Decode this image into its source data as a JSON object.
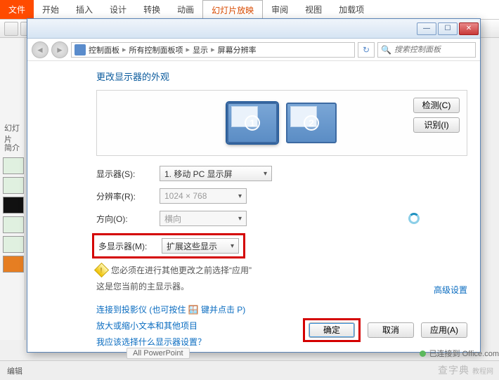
{
  "ribbon": {
    "file": "文件",
    "tabs": [
      "开始",
      "插入",
      "设计",
      "转换",
      "动画",
      "幻灯片放映",
      "审阅",
      "视图",
      "加载项"
    ],
    "active_index": 5
  },
  "left_panel": {
    "label_slides": "幻灯片",
    "label_outline": "简介"
  },
  "window": {
    "controls": {
      "min": "—",
      "max": "☐",
      "close": "✕"
    },
    "breadcrumb": [
      "控制面板",
      "所有控制面板项",
      "显示",
      "屏幕分辨率"
    ],
    "search_placeholder": "搜索控制面板",
    "heading": "更改显示器的外观",
    "panel_buttons": {
      "detect": "检测(C)",
      "identify": "识别(I)"
    },
    "monitors": [
      "1",
      "2"
    ],
    "labels": {
      "display": "显示器(S):",
      "resolution": "分辨率(R):",
      "orientation": "方向(O):",
      "multi": "多显示器(M):"
    },
    "values": {
      "display": "1. 移动 PC 显示屏",
      "resolution": "1024 × 768",
      "orientation": "横向",
      "multi": "扩展这些显示"
    },
    "warn": "您必须在进行其他更改之前选择“应用”",
    "primary_note": "这是您当前的主显示器。",
    "advanced": "高级设置",
    "links": {
      "projector": "连接到投影仪 (也可按住 🪟 键并点击 P)",
      "textsize": "放大或缩小文本和其他项目",
      "whichsetting": "我应该选择什么显示器设置？"
    },
    "buttons": {
      "ok": "确定",
      "cancel": "取消",
      "apply": "应用(A)"
    }
  },
  "status": {
    "edit_label": "编辑",
    "all_pp": "All PowerPoint",
    "conn": "已连接到 Office.com"
  },
  "watermark": {
    "main": "查字典",
    "sub": "教程网"
  }
}
